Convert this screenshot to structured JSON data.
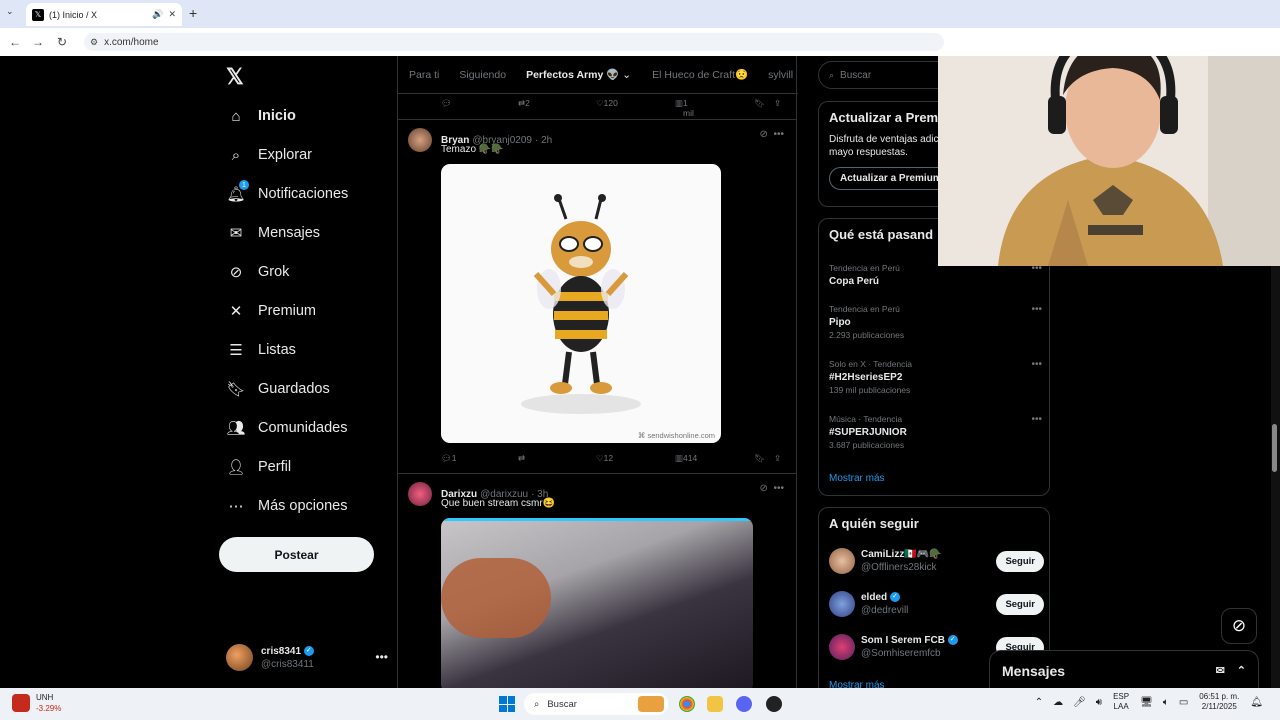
{
  "browser": {
    "tab_title": "(1) Inicio / X",
    "url": "x.com/home"
  },
  "nav": {
    "items": [
      {
        "label": "Inicio",
        "icon": "home-icon"
      },
      {
        "label": "Explorar",
        "icon": "search-icon"
      },
      {
        "label": "Notificaciones",
        "icon": "bell-icon",
        "badge": "1"
      },
      {
        "label": "Mensajes",
        "icon": "mail-icon"
      },
      {
        "label": "Grok",
        "icon": "grok-icon"
      },
      {
        "label": "Premium",
        "icon": "x-icon"
      },
      {
        "label": "Listas",
        "icon": "list-icon"
      },
      {
        "label": "Guardados",
        "icon": "bookmark-icon"
      },
      {
        "label": "Comunidades",
        "icon": "people-icon"
      },
      {
        "label": "Perfil",
        "icon": "person-icon"
      },
      {
        "label": "Más opciones",
        "icon": "more-circle-icon"
      }
    ],
    "post_button": "Postear",
    "profile": {
      "name": "cris8341",
      "handle": "@cris83411"
    }
  },
  "feed": {
    "tabs": [
      "Para ti",
      "Siguiendo",
      "Perfectos Army 👽",
      "El Hueco de Craft😟",
      "sylvill"
    ],
    "top_actions": {
      "replies": "",
      "reposts": "2",
      "likes": "120",
      "views": "1 mil"
    },
    "tweets": [
      {
        "name": "Bryan",
        "handle": "@bryanj0209",
        "time": "· 2h",
        "text": "Temazo 🪖🪖",
        "media_watermark": "⌘ sendwishonline.com",
        "replies": "1",
        "reposts": "",
        "likes": "12",
        "views": "414"
      },
      {
        "name": "Darixzu",
        "handle": "@darixzuu",
        "time": "· 3h",
        "text": "Que buen stream csmr😆"
      }
    ]
  },
  "sidebar": {
    "search_placeholder": "Buscar",
    "premium": {
      "title": "Actualizar a Prem",
      "desc": "Disfruta de ventajas adic total de anuncios y mayo respuestas.",
      "button": "Actualizar a Premium"
    },
    "trends_title": "Qué está pasand",
    "trends": [
      {
        "meta": "Tendencia en Perú",
        "title": "Copa Perú",
        "count": ""
      },
      {
        "meta": "Tendencia en Perú",
        "title": "Pipo",
        "count": "2.293 publicaciones"
      },
      {
        "meta": "Solo en X · Tendencia",
        "title": "#H2HseriesEP2",
        "count": "139 mil publicaciones"
      },
      {
        "meta": "Música · Tendencia",
        "title": "#SUPERJUNIOR",
        "count": "3.687 publicaciones"
      }
    ],
    "show_more": "Mostrar más",
    "who_title": "A quién seguir",
    "who": [
      {
        "name": "CamiLizz🇲🇽🎮🪖",
        "handle": "@Offliners28kick",
        "button": "Seguir"
      },
      {
        "name": "elded",
        "handle": "@dedrevill",
        "button": "Seguir"
      },
      {
        "name": "Som I Serem FCB",
        "handle": "@Somhiseremfcb",
        "button": "Seguir"
      }
    ],
    "show_more_2": "Mostrar más"
  },
  "messages_dock": {
    "title": "Mensajes"
  },
  "taskbar": {
    "stock_name": "UNH",
    "stock_change": "-3.29%",
    "search": "Buscar",
    "lang": "ESP",
    "lang2": "LAA",
    "time": "06:51 p. m.",
    "date": "2/11/2025"
  },
  "colors": {
    "accent": "#1d9bf0",
    "bg": "#000000",
    "border": "#2f3336"
  }
}
